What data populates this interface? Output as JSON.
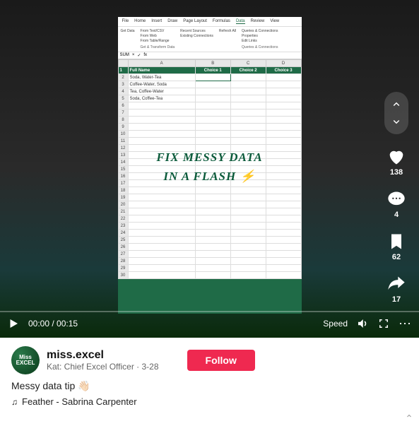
{
  "ribbon": {
    "tabs": [
      "File",
      "Home",
      "Insert",
      "Draw",
      "Page Layout",
      "Formulas",
      "Data",
      "Review",
      "View"
    ],
    "active_tab": "Data",
    "group1": {
      "label": "Get & Transform Data",
      "btn_main": "Get Data",
      "items": [
        "From Text/CSV",
        "From Web",
        "From Table/Range"
      ]
    },
    "group2": {
      "items": [
        "Recent Sources",
        "Existing Connections"
      ]
    },
    "group3": {
      "btn": "Refresh All",
      "items": [
        "Queries & Connections",
        "Properties",
        "Edit Links"
      ],
      "label": "Queries & Connections"
    }
  },
  "formula_bar": {
    "name_box": "SUM",
    "fx": "fx"
  },
  "sheet": {
    "cols": [
      "A",
      "B",
      "C",
      "D"
    ],
    "rows_shown": 30,
    "header": [
      "Full Name",
      "Choice 1",
      "Choice 2",
      "Choice 3"
    ],
    "data": [
      [
        "Soda, Water-Tea",
        "",
        "",
        ""
      ],
      [
        "Coffee-Water, Soda",
        "",
        "",
        ""
      ],
      [
        "Tea, Coffee-Water",
        "",
        "",
        ""
      ],
      [
        "Soda, Coffee-Tea",
        "",
        "",
        ""
      ]
    ]
  },
  "overlay": {
    "line1": "FIX MESSY DATA",
    "line2": "IN A FLASH ⚡"
  },
  "stats": {
    "likes": "138",
    "comments": "4",
    "saves": "62",
    "shares": "17"
  },
  "player": {
    "time": "00:00 / 00:15",
    "speed": "Speed"
  },
  "profile": {
    "username": "miss.excel",
    "bio": "Kat: Chief Excel Officer",
    "date": "3-28",
    "follow": "Follow",
    "avatar_text": "Miss EXCEL"
  },
  "caption": "Messy data tip 👋🏻",
  "music": "Feather - Sabrina Carpenter"
}
